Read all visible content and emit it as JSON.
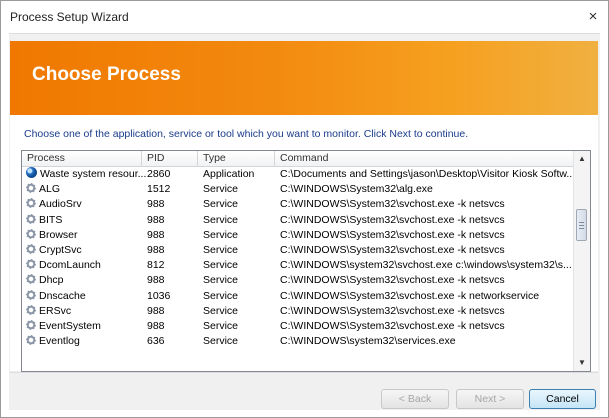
{
  "window": {
    "title": "Process Setup Wizard",
    "close_symbol": "×"
  },
  "banner": {
    "title": "Choose Process"
  },
  "instruction": "Choose one of the application, service or tool which you want to monitor. Click Next to continue.",
  "columns": [
    "Process",
    "PID",
    "Type",
    "Command"
  ],
  "rows": [
    {
      "process": "Waste system resour...",
      "pid": "2860",
      "type": "Application",
      "command": "C:\\Documents and Settings\\jason\\Desktop\\Visitor Kiosk Softw...",
      "icon": "app-icon"
    },
    {
      "process": "ALG",
      "pid": "1512",
      "type": "Service",
      "command": "C:\\WINDOWS\\System32\\alg.exe",
      "icon": "gear-icon"
    },
    {
      "process": "AudioSrv",
      "pid": "988",
      "type": "Service",
      "command": "C:\\WINDOWS\\System32\\svchost.exe -k netsvcs",
      "icon": "gear-icon"
    },
    {
      "process": "BITS",
      "pid": "988",
      "type": "Service",
      "command": "C:\\WINDOWS\\System32\\svchost.exe -k netsvcs",
      "icon": "gear-icon"
    },
    {
      "process": "Browser",
      "pid": "988",
      "type": "Service",
      "command": "C:\\WINDOWS\\System32\\svchost.exe -k netsvcs",
      "icon": "gear-icon"
    },
    {
      "process": "CryptSvc",
      "pid": "988",
      "type": "Service",
      "command": "C:\\WINDOWS\\System32\\svchost.exe -k netsvcs",
      "icon": "gear-icon"
    },
    {
      "process": "DcomLaunch",
      "pid": "812",
      "type": "Service",
      "command": "C:\\WINDOWS\\system32\\svchost.exe c:\\windows\\system32\\s...",
      "icon": "gear-icon"
    },
    {
      "process": "Dhcp",
      "pid": "988",
      "type": "Service",
      "command": "C:\\WINDOWS\\System32\\svchost.exe -k netsvcs",
      "icon": "gear-icon"
    },
    {
      "process": "Dnscache",
      "pid": "1036",
      "type": "Service",
      "command": "C:\\WINDOWS\\System32\\svchost.exe -k networkservice",
      "icon": "gear-icon"
    },
    {
      "process": "ERSvc",
      "pid": "988",
      "type": "Service",
      "command": "C:\\WINDOWS\\System32\\svchost.exe -k netsvcs",
      "icon": "gear-icon"
    },
    {
      "process": "EventSystem",
      "pid": "988",
      "type": "Service",
      "command": "C:\\WINDOWS\\System32\\svchost.exe -k netsvcs",
      "icon": "gear-icon"
    },
    {
      "process": "Eventlog",
      "pid": "636",
      "type": "Service",
      "command": "C:\\WINDOWS\\system32\\services.exe",
      "icon": "gear-icon"
    }
  ],
  "scrollbar": {
    "up_symbol": "▲",
    "down_symbol": "▼"
  },
  "buttons": {
    "back": "< Back",
    "next": "Next >",
    "cancel": "Cancel"
  },
  "colors": {
    "banner_start": "#f07800",
    "banner_end": "#f0b040",
    "instruction_text": "#1a3c8a"
  }
}
